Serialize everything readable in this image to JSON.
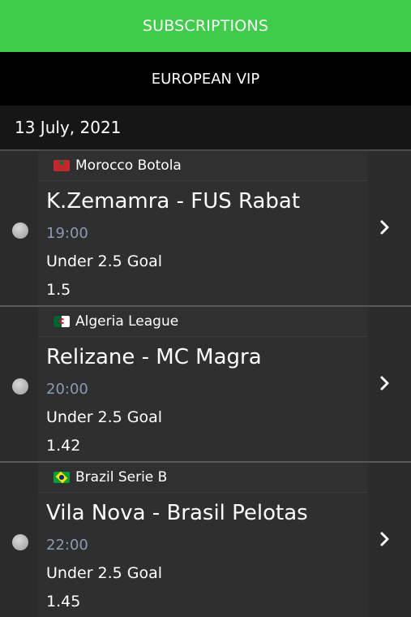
{
  "header": {
    "subscriptions_label": "SUBSCRIPTIONS",
    "section_label": "EUROPEAN VIP",
    "date": "13 July, 2021"
  },
  "colors": {
    "accent_green": "#3fcc4a",
    "time_text": "#8a9bb3"
  },
  "matches": [
    {
      "flag": "morocco-flag",
      "league": "Morocco Botola",
      "teams": "K.Zemamra - FUS Rabat",
      "time": "19:00",
      "market": "Under 2.5 Goal",
      "odds": "1.5"
    },
    {
      "flag": "algeria-flag",
      "league": "Algeria League",
      "teams": "Relizane - MC Magra",
      "time": "20:00",
      "market": "Under 2.5 Goal",
      "odds": "1.42"
    },
    {
      "flag": "brazil-flag",
      "league": "Brazil Serie B",
      "teams": "Vila Nova - Brasil Pelotas",
      "time": "22:00",
      "market": "Under 2.5 Goal",
      "odds": "1.45"
    }
  ]
}
